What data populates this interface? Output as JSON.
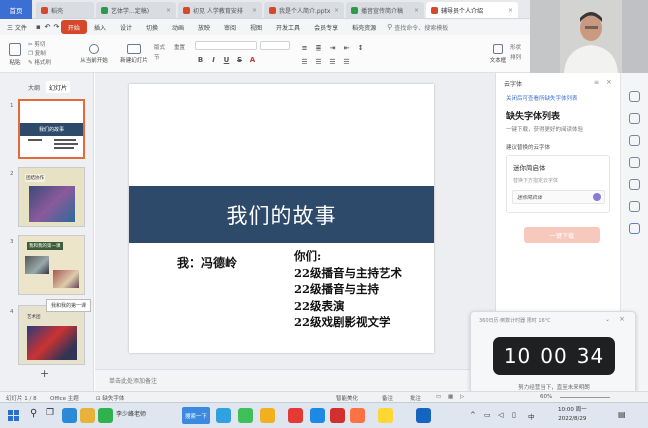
{
  "tabbar": {
    "home": "首页",
    "tabs": [
      {
        "label": "稻壳",
        "color": "#d6482b"
      },
      {
        "label": "艺体学...定稿)",
        "color": "#2b9a4a"
      },
      {
        "label": "初见 人学教育安排",
        "color": "#d6482b"
      },
      {
        "label": "我是个人简介.pptx",
        "color": "#d6482b"
      },
      {
        "label": "播音宣传简介稿",
        "color": "#2b9a4a"
      },
      {
        "label": "辅导员个人介绍",
        "color": "#d6482b"
      }
    ]
  },
  "menubar": {
    "file": "三 文件",
    "start": "开始",
    "items": [
      "插入",
      "设计",
      "切换",
      "动画",
      "放映",
      "审阅",
      "视图",
      "开发工具",
      "会员专享",
      "稻壳资源"
    ],
    "search": "查找命令、搜索模板"
  },
  "ribbon": {
    "paste": "粘贴",
    "cut": "剪切",
    "copy": "复制",
    "format_painter": "格式刷",
    "play_from_current": "从当前开始",
    "new_slide": "新建幻灯片",
    "layout": "版式",
    "section": "节",
    "reset": "重置",
    "textbox": "文本框",
    "shape": "形状",
    "arrange": "排列"
  },
  "leftpanel": {
    "tab_outline": "大纲",
    "tab_slides": "幻灯片",
    "thumbs": [
      {
        "num": "1",
        "title": "我们的故事"
      },
      {
        "num": "2",
        "title": "团结协作"
      },
      {
        "num": "3",
        "title": "我和我的第一课"
      },
      {
        "num": "4",
        "title": "艺术团"
      }
    ],
    "tooltip": "我和我的第一课",
    "add": "+"
  },
  "slide": {
    "title": "我们的故事",
    "me": "我：冯德岭",
    "classes": [
      "你们:",
      "22级播音与主持艺术",
      "22级播音与主持",
      "22级表演",
      "22级戏剧影视文学"
    ]
  },
  "notes": {
    "placeholder": "单击此处添加备注"
  },
  "rightpanel": {
    "header": "云字体",
    "link": "关闭后可查看所缺失字体列表",
    "title": "缺失字体列表",
    "subtitle": "一键下载，获得更好的阅读体验",
    "recommend": "建议替换的云字体",
    "font_name": "迷你简启体",
    "font_desc": "替换下方指定云字体",
    "preview": "迷你简启体",
    "download_button": "一键下载"
  },
  "timer": {
    "title": "360日历·倒数计时器 限时 16°C",
    "hours": "10",
    "minutes": "00",
    "seconds": "34",
    "motto": "努力经营当下，直至未来明朗"
  },
  "statusbar": {
    "slide_indicator": "幻灯片 1 / 8",
    "theme": "Office 主题",
    "missing_font": "缺失字体",
    "beautify": "智能美化",
    "notes": "备注",
    "comments": "批注",
    "zoom": "60%"
  },
  "taskbar": {
    "search_placeholder": "搜索一下",
    "user": "李少峰老师",
    "time": "10:00 周一",
    "date": "2022/8/29",
    "lang": "中"
  },
  "colors": {
    "accent": "#d6482b",
    "slide_band": "#2d4a6b",
    "selected_thumb": "#e56a3a",
    "download_button": "#f6c9bc"
  }
}
